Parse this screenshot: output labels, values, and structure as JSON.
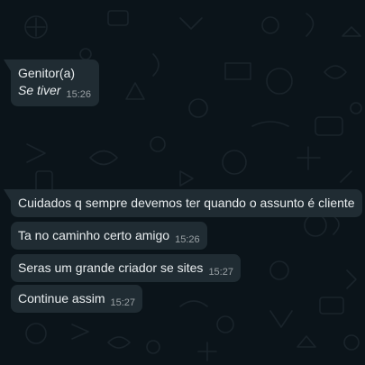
{
  "messages": [
    {
      "sender": "Genitor(a)",
      "text": "Se tiver",
      "time": "15:26"
    },
    {
      "text": "Cuidados q sempre devemos ter quando o assunto é cliente",
      "time": ""
    },
    {
      "text": "Ta no caminho certo amigo",
      "time": "15:26"
    },
    {
      "text": "Seras um grande criador se sites",
      "time": "15:27"
    },
    {
      "text": "Continue assim",
      "time": "15:27"
    }
  ],
  "colors": {
    "background": "#0b141a",
    "bubble": "#202c33",
    "text": "#e9edef",
    "meta": "#8696a0"
  }
}
